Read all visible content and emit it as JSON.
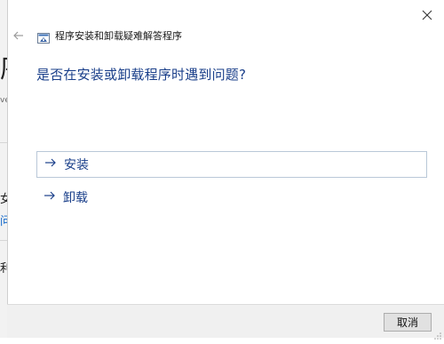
{
  "background": {
    "fragments": [
      "序",
      "ve",
      "女",
      "问",
      "利"
    ]
  },
  "dialog": {
    "title": "程序安装和卸载疑难解答程序",
    "question": "是否在安装或卸载程序时遇到问题?",
    "options": [
      {
        "label": "安装",
        "focused": true
      },
      {
        "label": "卸载",
        "focused": false
      }
    ],
    "cancel_label": "取消",
    "colors": {
      "accent": "#1a3f8a",
      "footer_bg": "#f0f0f0",
      "focus_border": "#b9c8d8"
    }
  }
}
